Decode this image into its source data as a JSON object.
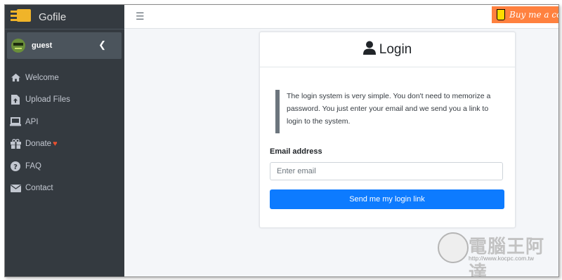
{
  "app": {
    "title": "Gofile"
  },
  "sidebar": {
    "user": {
      "name": "guest"
    },
    "collapse_icon": "chevron-left-icon",
    "items": [
      {
        "label": "Welcome",
        "icon": "home-icon"
      },
      {
        "label": "Upload Files",
        "icon": "file-upload-icon"
      },
      {
        "label": "API",
        "icon": "laptop-icon"
      },
      {
        "label": "Donate",
        "icon": "gift-icon",
        "badge_icon": "heart-icon"
      },
      {
        "label": "FAQ",
        "icon": "question-circle-icon"
      },
      {
        "label": "Contact",
        "icon": "envelope-icon"
      }
    ]
  },
  "topbar": {
    "menu_icon": "hamburger-icon",
    "coffee_button": {
      "label": "Buy me a coff",
      "color": "#ff813f"
    }
  },
  "login": {
    "title": "Login",
    "title_icon": "user-icon",
    "info_text": "The login system is very simple. You don't need to memorize a password. You just enter your email and we send you a link to login to the system.",
    "email_label": "Email address",
    "email_placeholder": "Enter email",
    "email_value": "",
    "submit_label": "Send me my login link",
    "accent": "#0d7bff"
  },
  "watermark": {
    "title": "電腦王阿達",
    "url": "http://www.kocpc.com.tw"
  }
}
